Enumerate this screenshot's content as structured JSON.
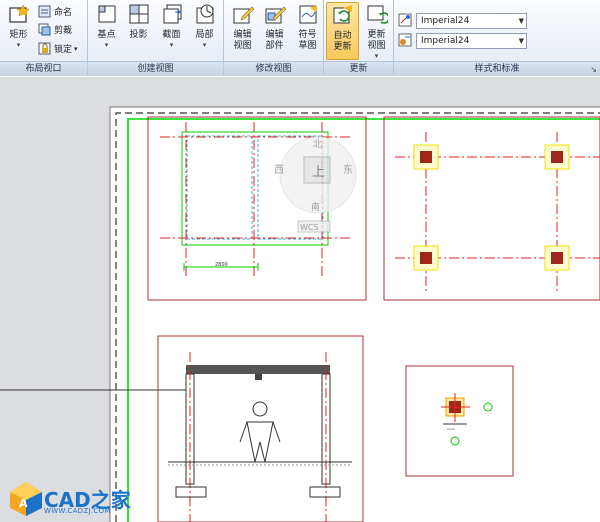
{
  "ribbon": {
    "panels": [
      {
        "title": "布局视口"
      },
      {
        "title": "创建视图"
      },
      {
        "title": "修改视图"
      },
      {
        "title": "更新"
      },
      {
        "title": "样式和标准"
      }
    ],
    "layout_viewport": {
      "rectangle": "矩形",
      "name": "命名",
      "clip": "剪裁",
      "lock": "锁定"
    },
    "create_view": {
      "base": "基点",
      "projected": "投影",
      "section": "截面",
      "detail": "局部"
    },
    "modify_view": {
      "edit_view": [
        "编辑",
        "视图"
      ],
      "edit_components": [
        "编辑",
        "部件"
      ],
      "symbol_sketch": [
        "符号",
        "草图"
      ]
    },
    "update": {
      "auto_update": [
        "自动",
        "更新"
      ],
      "update_view": [
        "更新",
        "视图"
      ]
    },
    "styles": {
      "combo1": "Imperial24",
      "combo2": "Imperial24"
    }
  },
  "viewcube": {
    "top": "上",
    "north": "北",
    "south": "南",
    "west": "西",
    "east": "东",
    "wcs": "WCS"
  },
  "drawing": {
    "dim_label": "2800",
    "dim_small": "1mm"
  },
  "logo": {
    "text": "CAD之家",
    "url": "WWW.CADZJ.COM"
  },
  "colors": {
    "accent": "#d6a53a",
    "frame_green": "#00dd00",
    "red_line": "#e02020",
    "column_fill": "#a0261b",
    "column_outline": "#f0e000",
    "logo_blue": "#1a72c9"
  }
}
